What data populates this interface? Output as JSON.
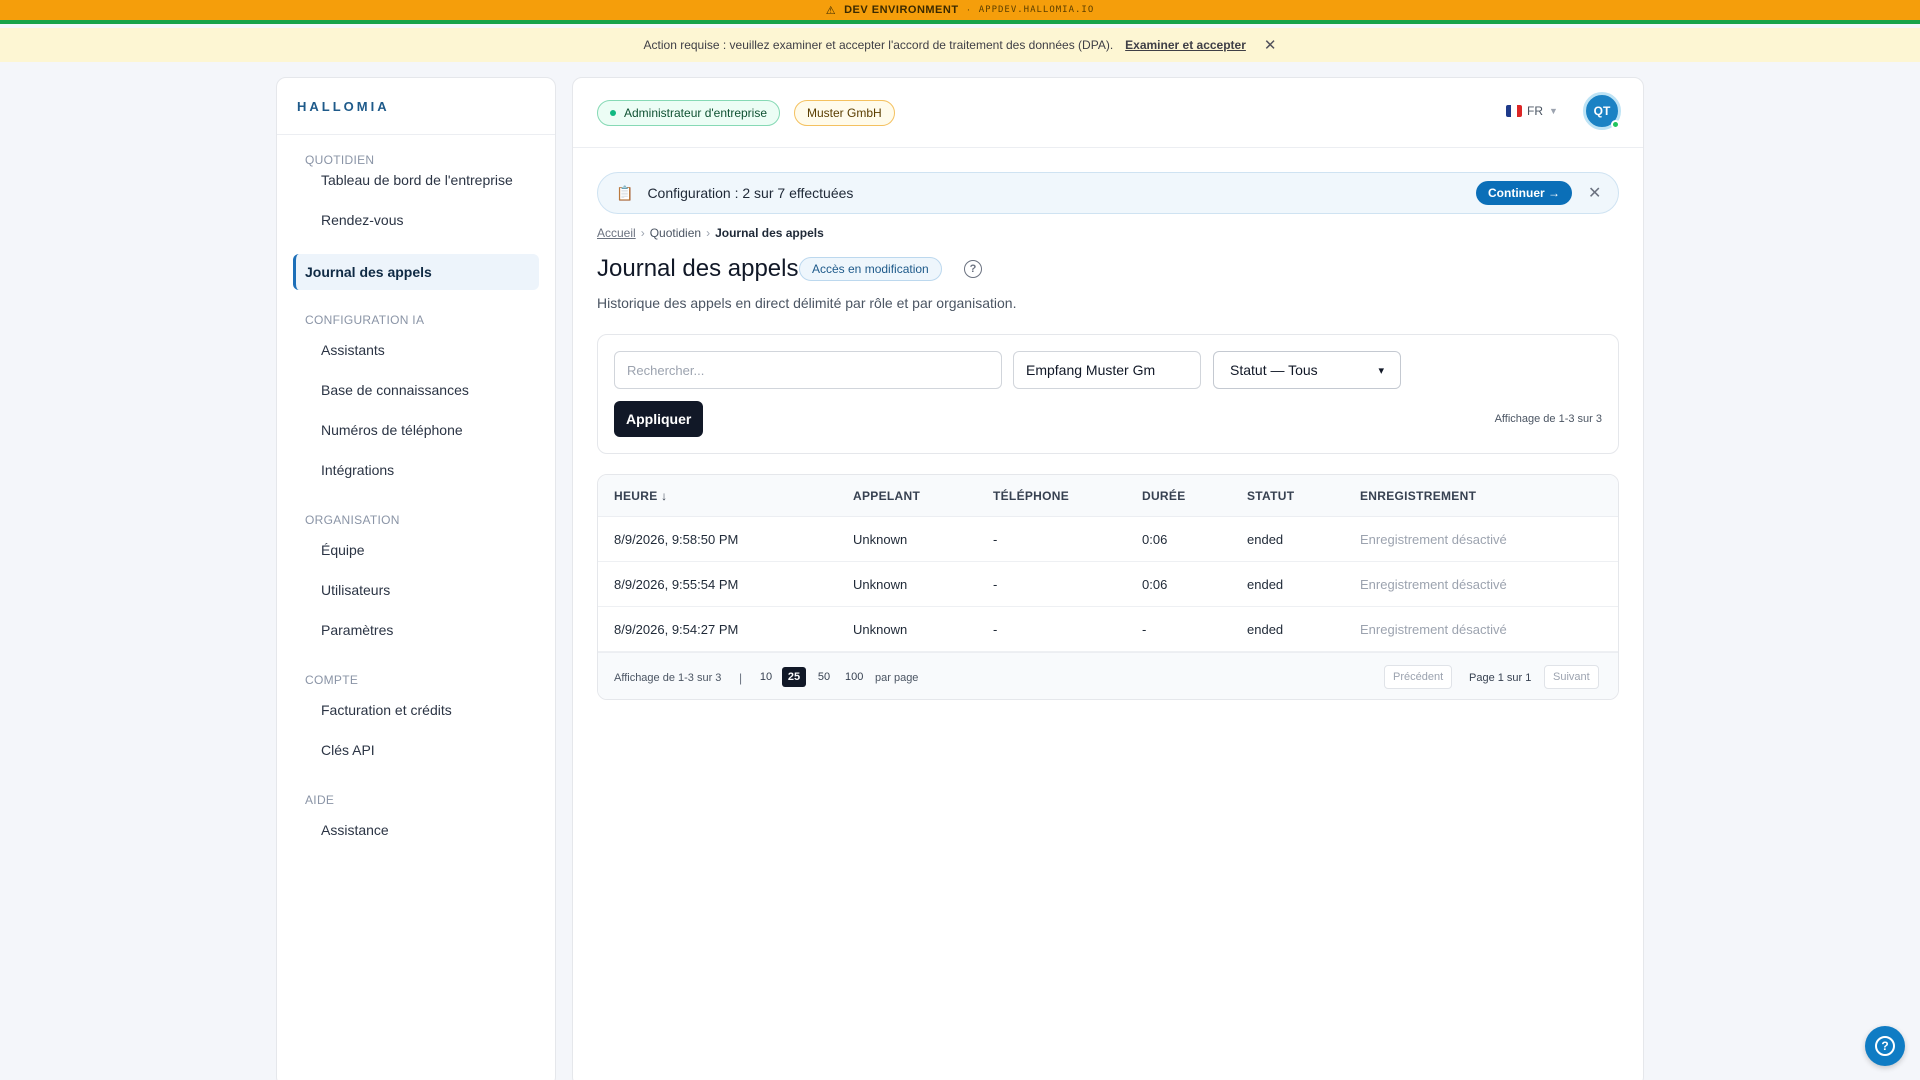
{
  "dev_banner": {
    "icon": "warning-icon",
    "label": "DEV ENVIRONMENT",
    "separator": "·",
    "host": "APPDEV.HALLOMIA.IO",
    "color": "#f59e0b"
  },
  "action_banner": {
    "text": "Action requise : veuillez examiner et accepter l'accord de traitement des données (DPA).",
    "link": "Examiner et accepter",
    "close": "✕"
  },
  "sidebar": {
    "brand": "HALLOMIA",
    "sections": [
      {
        "label": "QUOTIDIEN",
        "items": [
          "Tableau de bord de l'entreprise",
          "Rendez-vous",
          "Journal des appels"
        ]
      },
      {
        "label": "CONFIGURATION IA",
        "items": [
          "Assistants",
          "Base de connaissances",
          "Numéros de téléphone",
          "Intégrations"
        ]
      },
      {
        "label": "ORGANISATION",
        "items": [
          "Équipe",
          "Utilisateurs",
          "Paramètres"
        ]
      },
      {
        "label": "COMPTE",
        "items": [
          "Facturation et crédits",
          "Clés API"
        ]
      },
      {
        "label": "AIDE",
        "items": [
          "Assistance"
        ]
      }
    ],
    "active_item": "Journal des appels"
  },
  "topbar": {
    "role_badge": "Administrateur d'entreprise",
    "org_badge": "Muster GmbH",
    "language": "FR",
    "avatar_initials": "QT"
  },
  "config_banner": {
    "icon": "clipboard-icon",
    "text": "Configuration : 2 sur 7 effectuées",
    "continue": "Continuer →",
    "close": "✕"
  },
  "breadcrumb": {
    "home": "Accueil",
    "section": "Quotidien",
    "current": "Journal des appels",
    "separator": "›"
  },
  "page": {
    "title": "Journal des appels",
    "access_badge": "Accès en modification",
    "help": "?",
    "subtitle": "Historique des appels en direct délimité par rôle et par organisation."
  },
  "filters": {
    "search_placeholder": "Rechercher...",
    "org_value": "Empfang Muster Gm",
    "status_value": "Statut — Tous",
    "apply": "Appliquer",
    "showing": "Affichage de 1-3 sur 3"
  },
  "table": {
    "columns": [
      "HEURE ↓",
      "APPELANT",
      "TÉLÉPHONE",
      "DURÉE",
      "STATUT",
      "ENREGISTREMENT"
    ],
    "rows": [
      {
        "time": "8/9/2026, 9:58:50 PM",
        "caller": "Unknown",
        "phone": "-",
        "duration": "0:06",
        "status": "ended",
        "recording": "Enregistrement désactivé"
      },
      {
        "time": "8/9/2026, 9:55:54 PM",
        "caller": "Unknown",
        "phone": "-",
        "duration": "0:06",
        "status": "ended",
        "recording": "Enregistrement désactivé"
      },
      {
        "time": "8/9/2026, 9:54:27 PM",
        "caller": "Unknown",
        "phone": "-",
        "duration": "-",
        "status": "ended",
        "recording": "Enregistrement désactivé"
      }
    ],
    "footer": {
      "count": "Affichage de 1-3 sur 3",
      "pipe": "|",
      "page_sizes": [
        "10",
        "25",
        "50",
        "100"
      ],
      "selected_page_size": "25",
      "per_page": "par page",
      "prev": "Précédent",
      "page_info": "Page 1 sur 1",
      "next": "Suivant"
    }
  },
  "help_fab": {
    "icon": "help-circle-icon",
    "glyph": "?"
  },
  "colors": {
    "primary": "#0b6fb8",
    "dark": "#111827",
    "dev_green": "#16a34a"
  }
}
